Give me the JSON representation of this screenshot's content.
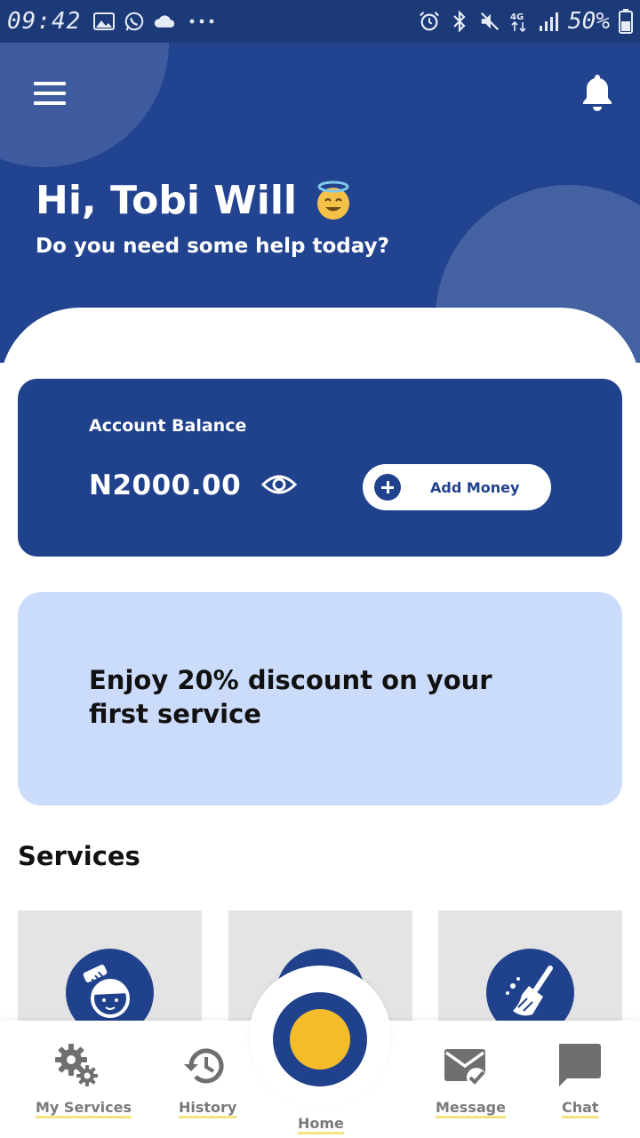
{
  "status_bar": {
    "time": "09:42",
    "battery": "50%",
    "network": "4G"
  },
  "header": {
    "greeting": "Hi, Tobi Will",
    "subtitle": "Do you need some help today?",
    "menu_icon": "hamburger-menu-icon",
    "notification_icon": "bell-icon"
  },
  "balance_card": {
    "label": "Account Balance",
    "amount": "N2000.00",
    "add_money_label": "Add Money"
  },
  "promo": {
    "text": "Enjoy 20% discount on your first service"
  },
  "services": {
    "title": "Services",
    "items": [
      {
        "icon": "hair-stylist-icon"
      },
      {
        "icon": "service-icon"
      },
      {
        "icon": "cleaning-broom-icon"
      }
    ]
  },
  "bottom_nav": {
    "items": [
      {
        "label": "My Services",
        "icon": "gears-icon"
      },
      {
        "label": "History",
        "icon": "history-icon"
      },
      {
        "label": "Home",
        "icon": "home-icon"
      },
      {
        "label": "Message",
        "icon": "mail-check-icon"
      },
      {
        "label": "Chat",
        "icon": "chat-bubble-icon"
      }
    ]
  },
  "colors": {
    "primary": "#20428c",
    "accent": "#f4bb2b",
    "promo_bg": "#cbdcfa",
    "tile_bg": "#e4e4e4"
  }
}
